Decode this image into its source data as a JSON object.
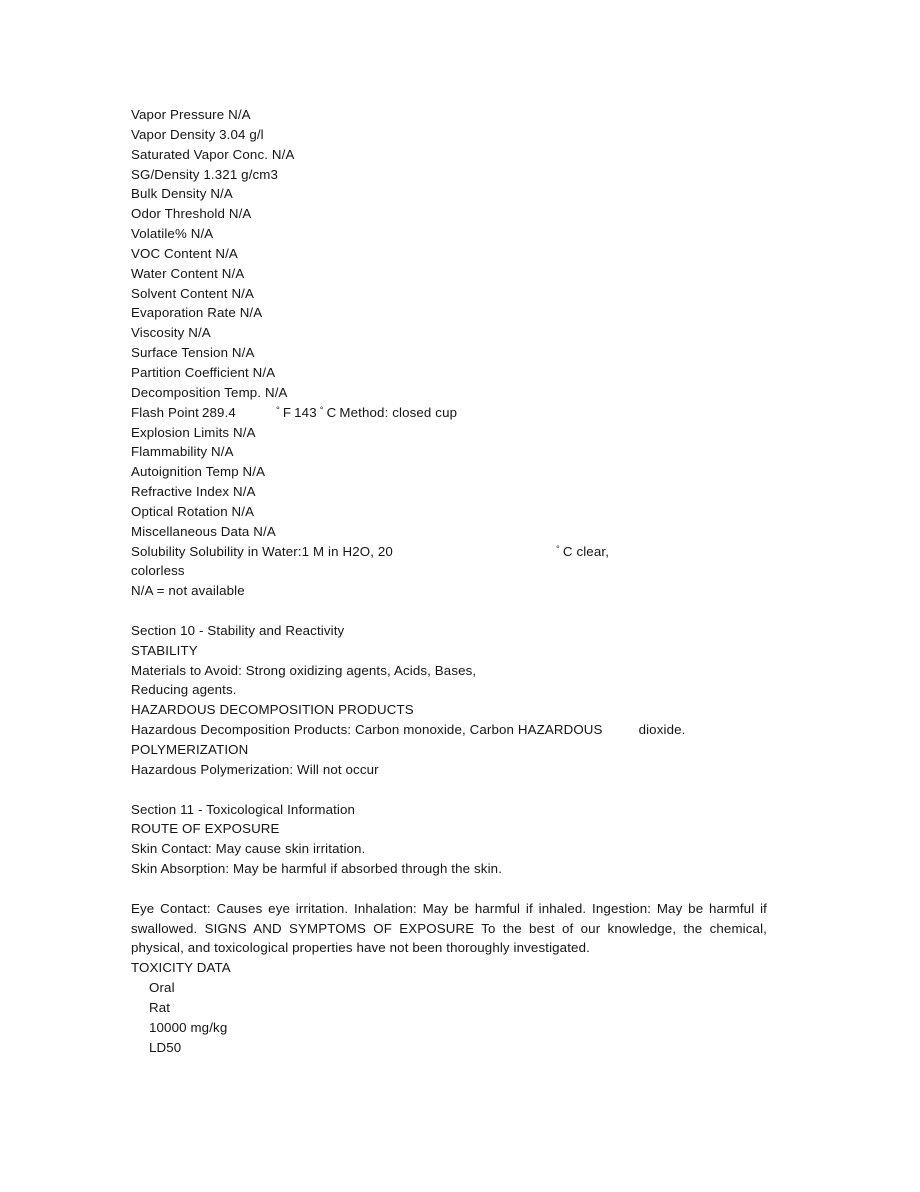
{
  "document": {
    "type": "msds-safety-data-sheet",
    "physical_properties": [
      "Vapor Pressure N/A",
      "Vapor Density 3.04 g/l",
      "Saturated Vapor Conc. N/A",
      "SG/Density 1.321 g/cm3",
      "Bulk Density N/A",
      "Odor Threshold N/A",
      "Volatile% N/A",
      "VOC Content N/A",
      "Water Content N/A",
      "Solvent Content N/A",
      "Evaporation Rate N/A",
      "Viscosity N/A",
      "Surface Tension N/A",
      "Partition Coefficient N/A",
      "Decomposition Temp. N/A"
    ],
    "flash_point": {
      "label": "Flash Point",
      "fahrenheit_value": "289.4",
      "degree_symbol": "°",
      "fahrenheit_unit": "F",
      "celsius_value": "143",
      "celsius_unit": "C",
      "method": "Method: closed cup"
    },
    "physical_properties_2": [
      "Explosion Limits N/A",
      "Flammability N/A",
      "Autoignition Temp N/A",
      "Refractive Index N/A",
      "Optical Rotation N/A",
      "Miscellaneous Data N/A"
    ],
    "solubility": {
      "text_before": "Solubility Solubility in Water:1 M in H2O, 20",
      "degree_symbol": "°",
      "text_after": "C clear,",
      "continuation": "colorless"
    },
    "na_note": "N/A = not available",
    "section10": {
      "heading": "Section 10 - Stability and Reactivity",
      "stability_heading": "STABILITY",
      "materials_to_avoid_line1": "Materials to Avoid: Strong oxidizing agents, Acids, Bases,",
      "materials_to_avoid_line2": "Reducing agents.",
      "decomposition_heading": "HAZARDOUS DECOMPOSITION PRODUCTS",
      "decomposition_products_main": "Hazardous Decomposition Products: Carbon monoxide, Carbon HAZARDOUS",
      "decomposition_products_trailing": "dioxide.",
      "polymerization_heading": "POLYMERIZATION",
      "polymerization_text": "Hazardous Polymerization: Will not occur"
    },
    "section11": {
      "heading": "Section 11 - Toxicological Information",
      "route_heading": "ROUTE OF EXPOSURE",
      "skin_contact": "Skin Contact: May cause skin irritation.",
      "skin_absorption": "Skin Absorption: May be harmful if absorbed through the skin.",
      "exposure_paragraph": "Eye Contact: Causes eye irritation. Inhalation: May be harmful if inhaled. Ingestion: May be harmful if swallowed. SIGNS AND SYMPTOMS OF EXPOSURE To the best of our knowledge, the chemical, physical, and toxicological properties have not been thoroughly investigated.",
      "toxicity_heading": "TOXICITY DATA",
      "toxicity_entries": [
        "Oral",
        "Rat",
        "10000 mg/kg",
        "LD50"
      ]
    }
  }
}
